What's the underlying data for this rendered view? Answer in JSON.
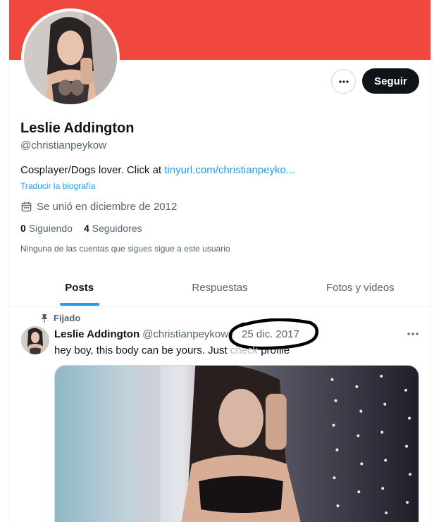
{
  "header": {
    "banner_color": "#f0473f",
    "more_icon": "more-horizontal-icon",
    "follow_label": "Seguir"
  },
  "profile": {
    "name": "Leslie Addington",
    "handle": "@christianpeykow",
    "bio_text": "Cosplayer/Dogs lover. Click at ",
    "bio_link": "tinyurl.com/christianpeyko...",
    "translate_label": "Traducir la biografía",
    "joined_icon": "calendar-icon",
    "joined_text": "Se unió en diciembre de 2012",
    "following_count": "0",
    "following_label": "Siguiendo",
    "followers_count": "4",
    "followers_label": "Seguidores",
    "mutual_text": "Ninguna de las cuentas que sigues sigue a este usuario"
  },
  "tabs": [
    {
      "label": "Posts",
      "active": true
    },
    {
      "label": "Respuestas",
      "active": false
    },
    {
      "label": "Fotos y videos",
      "active": false
    }
  ],
  "tweet": {
    "pinned_icon": "pin-icon",
    "pinned_label": "Fijado",
    "author_name": "Leslie Addington",
    "author_handle": "@christianpeykow",
    "separator": "·",
    "date": "25 dic. 2017",
    "text_visible": "hey boy, this body can be yours. Just ",
    "text_obscured": "check",
    "text_end": "profile",
    "more_icon": "more-horizontal-icon"
  },
  "colors": {
    "accent": "#1d9bf0",
    "text_primary": "#0f1419",
    "text_secondary": "#536471"
  }
}
